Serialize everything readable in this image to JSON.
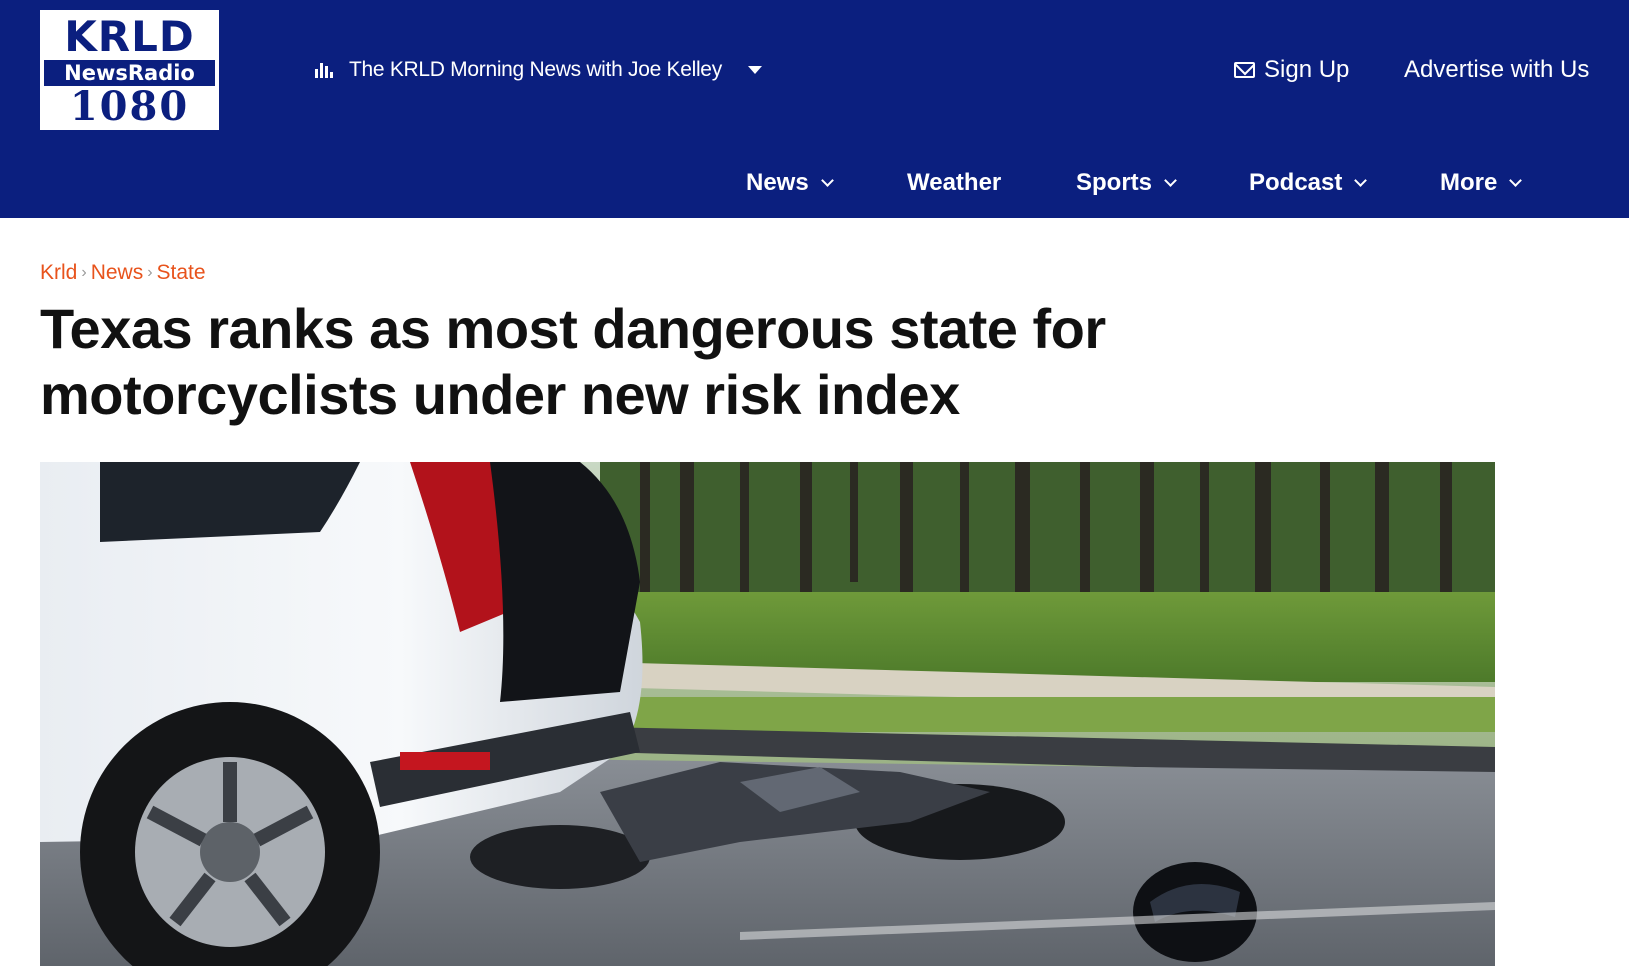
{
  "header": {
    "logo": {
      "line1": "KRLD",
      "line2": "NewsRadio",
      "line3": "1080"
    },
    "station": {
      "label": "The KRLD Morning News with Joe Kelley"
    },
    "signup_label": "Sign Up",
    "advertise_label": "Advertise with Us",
    "nav": [
      {
        "label": "News",
        "has_menu": true
      },
      {
        "label": "Weather",
        "has_menu": false
      },
      {
        "label": "Sports",
        "has_menu": true
      },
      {
        "label": "Podcast",
        "has_menu": true
      },
      {
        "label": "More",
        "has_menu": true
      }
    ]
  },
  "breadcrumb": [
    "Krld",
    "News",
    "State"
  ],
  "article": {
    "headline": "Texas ranks as most dangerous state for motorcyclists under new risk index"
  },
  "icons": [
    "audio-bars-icon",
    "caret-down-icon",
    "mail-icon",
    "chevron-down-icon"
  ],
  "colors": {
    "header_bg": "#0b1f7f",
    "breadcrumb": "#e8531c",
    "headline": "#111111",
    "header_text": "#ffffff"
  }
}
